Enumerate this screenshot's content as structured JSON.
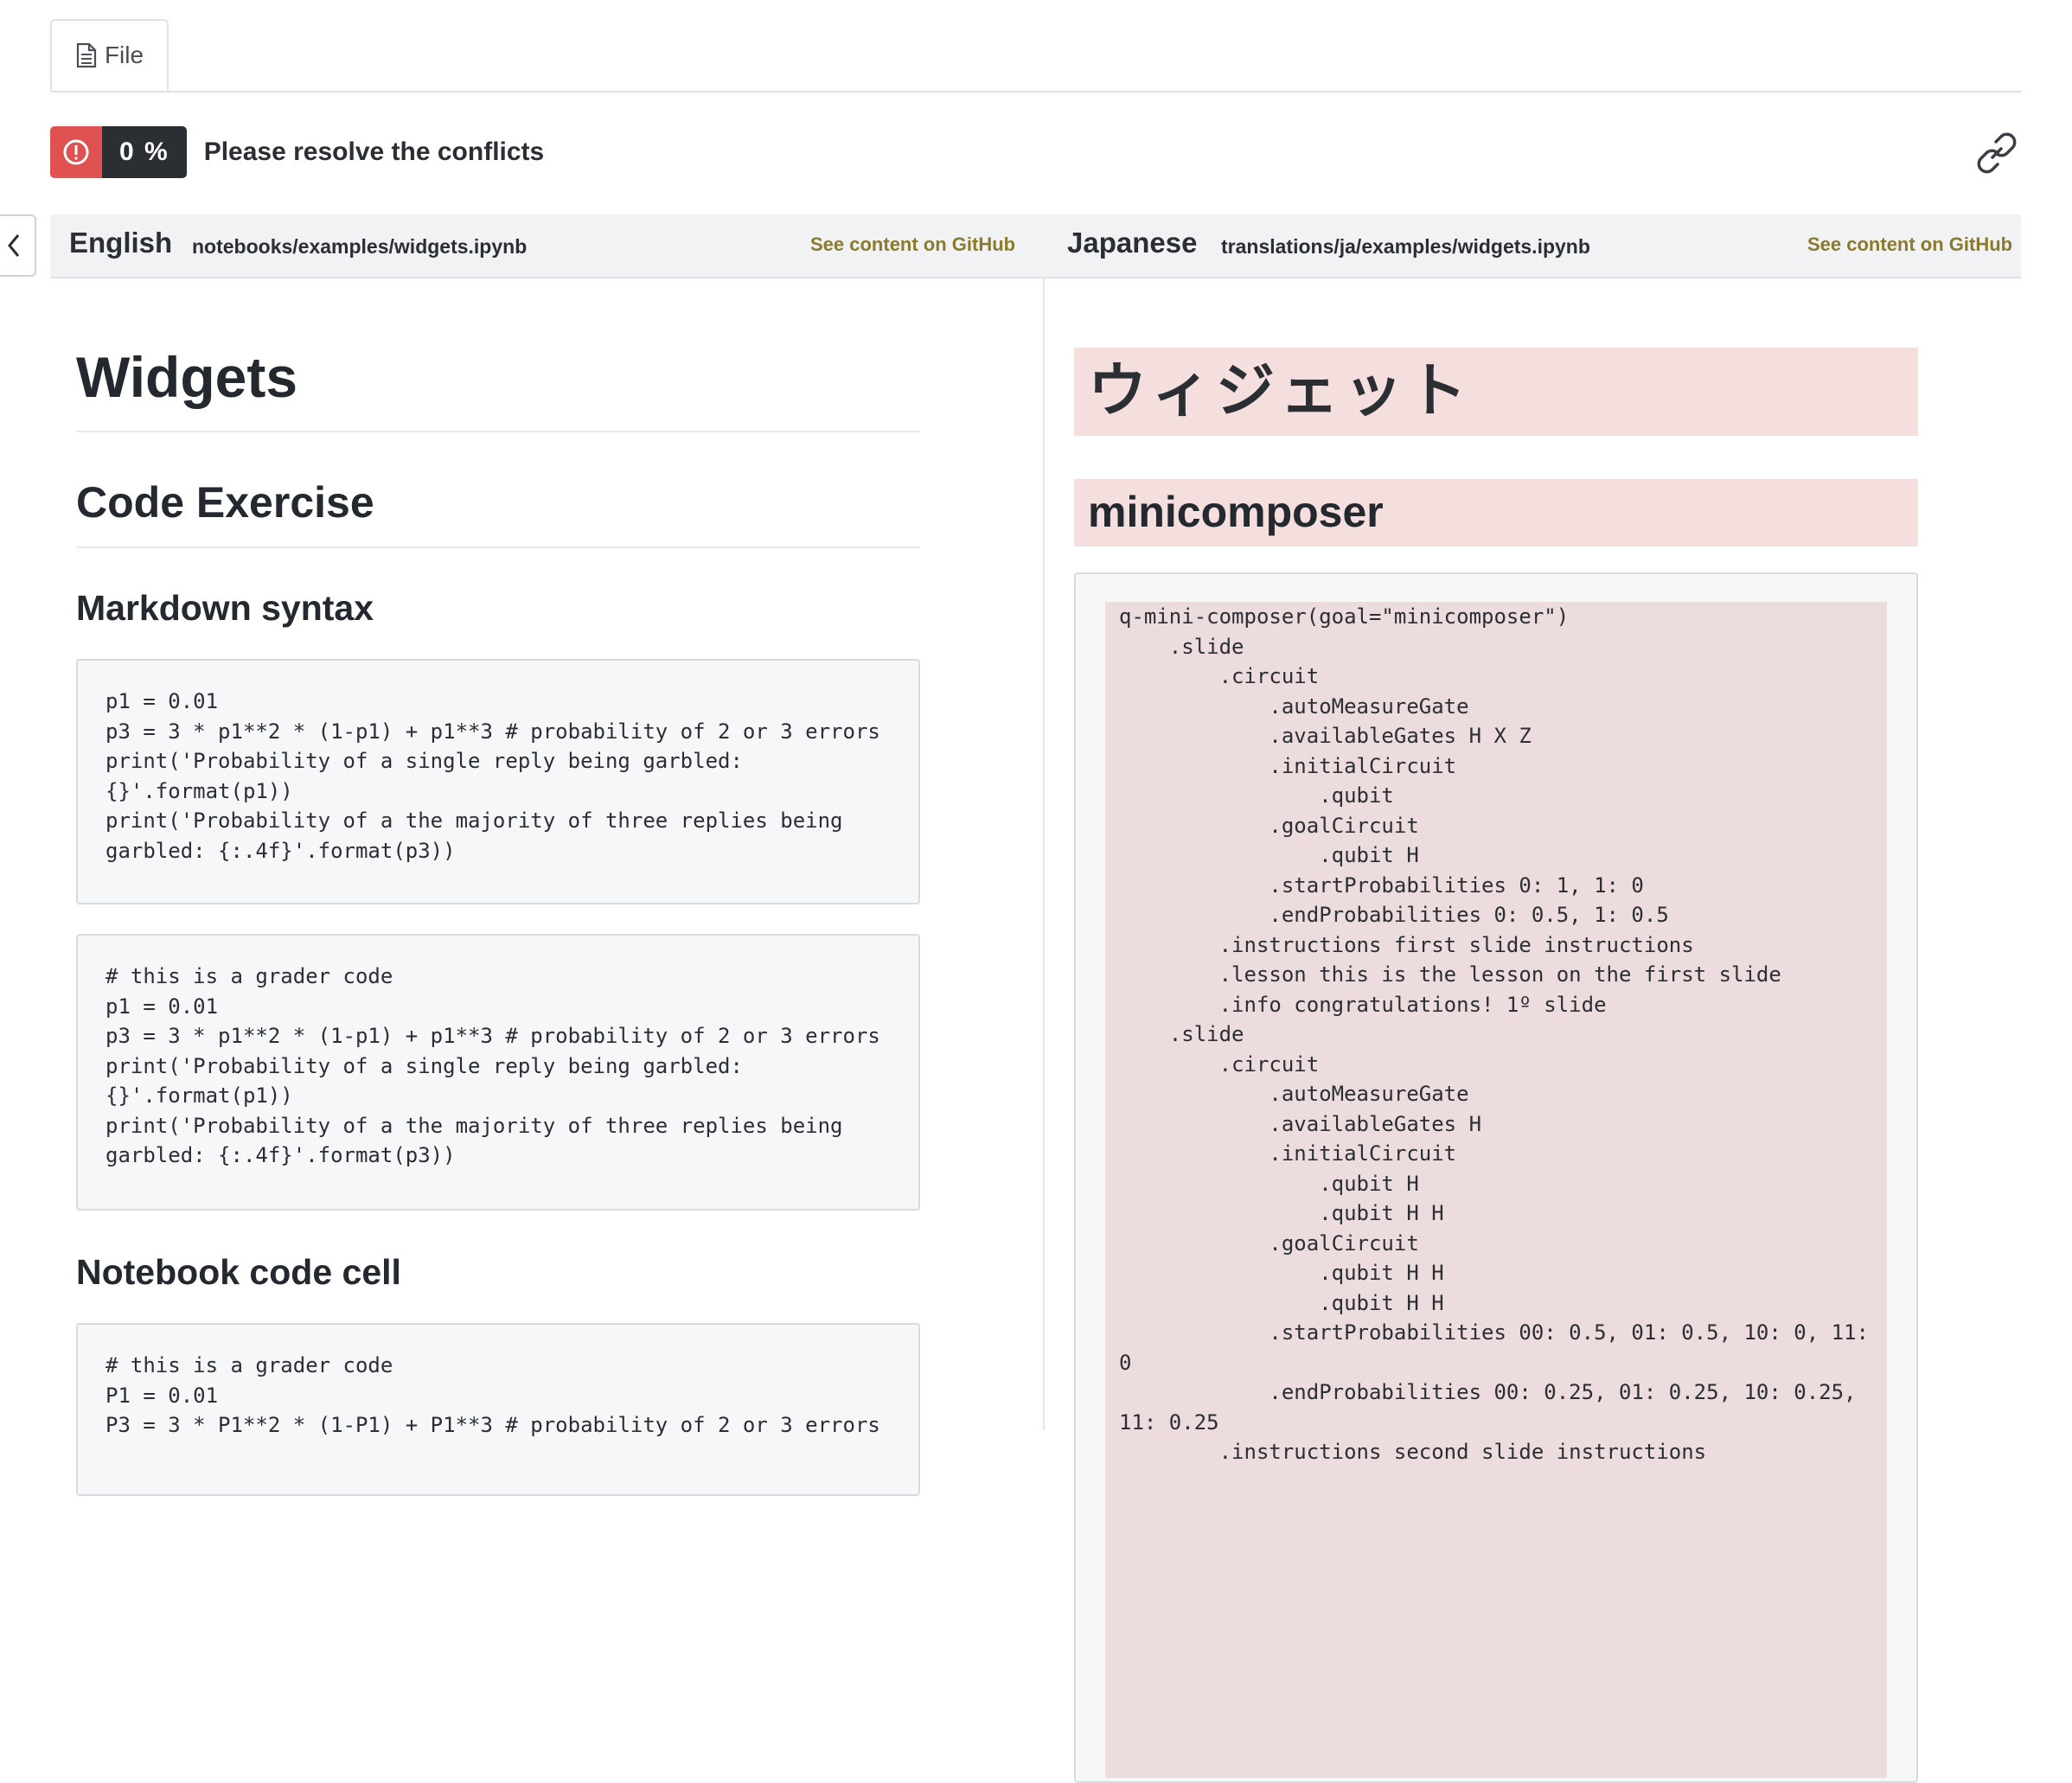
{
  "tabs": [
    {
      "label": "File",
      "icon": "document-icon"
    }
  ],
  "status": {
    "progress_text": "0 %",
    "progress_value": 0,
    "message": "Please resolve the conflicts",
    "color_error": "#e05252"
  },
  "panes": {
    "source": {
      "language": "English",
      "path": "notebooks/examples/widgets.ipynb",
      "github_link": "See content on GitHub"
    },
    "target": {
      "language": "Japanese",
      "path": "translations/ja/examples/widgets.ipynb",
      "github_link": "See content on GitHub"
    }
  },
  "left": {
    "title": "Widgets",
    "section": "Code Exercise",
    "subsection1": "Markdown syntax",
    "code1": "p1 = 0.01\np3 = 3 * p1**2 * (1-p1) + p1**3 # probability of 2 or 3 errors\nprint('Probability of a single reply being garbled:\n{}'.format(p1))\nprint('Probability of a the majority of three replies being\ngarbled: {:.4f}'.format(p3))",
    "code2": "# this is a grader code\np1 = 0.01\np3 = 3 * p1**2 * (1-p1) + p1**3 # probability of 2 or 3 errors\nprint('Probability of a single reply being garbled:\n{}'.format(p1))\nprint('Probability of a the majority of three replies being\ngarbled: {:.4f}'.format(p3))",
    "subsection2": "Notebook code cell",
    "code3": "# this is a grader code\nP1 = 0.01\nP3 = 3 * P1**2 * (1-P1) + P1**3 # probability of 2 or 3 errors"
  },
  "right": {
    "title": "ウィジェット",
    "section": "minicomposer",
    "code": "q-mini-composer(goal=\"minicomposer\")\n    .slide\n        .circuit\n            .autoMeasureGate\n            .availableGates H X Z\n            .initialCircuit\n                .qubit\n            .goalCircuit\n                .qubit H\n            .startProbabilities 0: 1, 1: 0\n            .endProbabilities 0: 0.5, 1: 0.5\n        .instructions first slide instructions\n        .lesson this is the lesson on the first slide\n        .info congratulations! 1º slide\n    .slide\n        .circuit\n            .autoMeasureGate\n            .availableGates H\n            .initialCircuit\n                .qubit H\n                .qubit H H\n            .goalCircuit\n                .qubit H H\n                .qubit H H\n            .startProbabilities 00: 0.5, 01: 0.5, 10: 0, 11:\n0\n            .endProbabilities 00: 0.25, 01: 0.25, 10: 0.25,\n11: 0.25\n        .instructions second slide instructions"
  }
}
